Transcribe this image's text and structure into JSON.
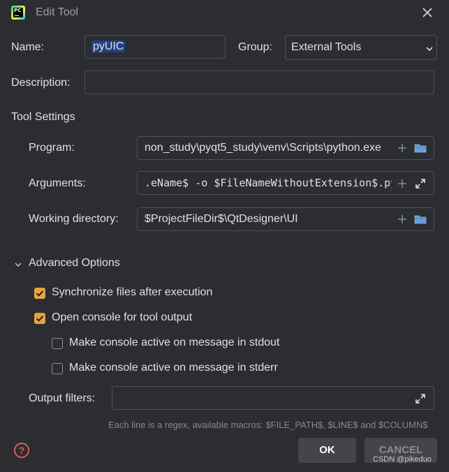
{
  "window": {
    "title": "Edit Tool",
    "app_icon_text": "PC"
  },
  "form": {
    "name_label": "Name:",
    "name_value": "pyUIC",
    "group_label": "Group:",
    "group_value": "External Tools",
    "description_label": "Description:",
    "description_value": ""
  },
  "tool_settings": {
    "section_label": "Tool Settings",
    "program_label": "Program:",
    "program_value": "non_study\\pyqt5_study\\venv\\Scripts\\python.exe",
    "arguments_label": "Arguments:",
    "arguments_value": ".eName$ -o $FileNameWithoutExtension$.py",
    "working_dir_label": "Working directory:",
    "working_dir_value": "$ProjectFileDir$\\QtDesigner\\UI"
  },
  "advanced": {
    "section_label": "Advanced Options",
    "sync_files_label": "Synchronize files after execution",
    "sync_files_checked": true,
    "open_console_label": "Open console for tool output",
    "open_console_checked": true,
    "console_stdout_label": "Make console active on message in stdout",
    "console_stdout_checked": false,
    "console_stderr_label": "Make console active on message in stderr",
    "console_stderr_checked": false,
    "output_filters_label": "Output filters:",
    "output_filters_value": "",
    "hint": "Each line is a regex, available macros: $FILE_PATH$, $LINE$ and $COLUMN$"
  },
  "buttons": {
    "ok_label": "OK",
    "cancel_label": "CANCEL"
  },
  "watermark": "CSDN @pikeduo",
  "colors": {
    "background": "#2b2d30",
    "checkbox_accent": "#e8a33e",
    "field_border": "#4e5157",
    "help_icon": "#db5c5c"
  },
  "icons": {
    "close": "close-icon",
    "dropdown": "chevron-down-icon",
    "add": "plus-icon",
    "folder": "folder-icon",
    "expand": "expand-icon",
    "collapse": "chevron-down-icon",
    "help": "help-icon"
  }
}
